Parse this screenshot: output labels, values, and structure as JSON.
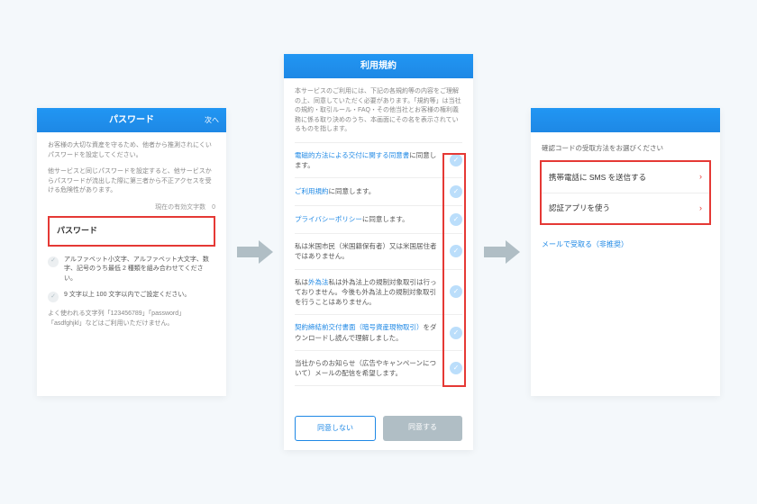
{
  "screen1": {
    "title": "パスワード",
    "next": "次へ",
    "desc1": "お客様の大切な資産を守るため、他者から推測されにくいパスワードを設定してください。",
    "desc2": "他サービスと同じパスワードを設定すると、他サービスからパスワードが流出した際に第三者から不正アクセスを受ける危険性があります。",
    "counter": "現在の有効文字数　0",
    "placeholder": "パスワード",
    "rule1": "アルファベット小文字、アルファベット大文字、数字、記号のうち最低 2 種類を組み合わせてください。",
    "rule2": "9 文字以上 100 文字以内でご設定ください。",
    "tip": "よく使われる文字列「123456789」「password」「asdfghjkl」などはご利用いただけません。"
  },
  "screen2": {
    "title": "利用規約",
    "intro": "本サービスのご利用には、下記の各規約等の内容をご理解の上、同意していただく必要があります。「規約等」は当社の規約・取引ルール・FAQ・その他当社とお客様の権利義務に係る取り決めのうち、本画面にその名を表示されているものを指します。",
    "terms": [
      {
        "link": "電磁的方法による交付に関する同意書",
        "rest": "に同意します。"
      },
      {
        "link": "ご利用規約",
        "rest": "に同意します。"
      },
      {
        "link": "プライバシーポリシー",
        "rest": "に同意します。"
      },
      {
        "link": "",
        "rest": "私は米国市民（米国籍保有者）又は米国居住者ではありません。"
      },
      {
        "link": "外為法",
        "rest": "私は外為法上の規制対象取引は行っておりません。今後も外為法上の規制対象取引を行うことはありません。",
        "prefix": "私は"
      },
      {
        "link": "契約締結前交付書面（暗号資産現物取引）",
        "rest": "をダウンロードし読んで理解しました。"
      },
      {
        "link": "",
        "rest": "当社からのお知らせ（広告やキャンペーンについて）メールの配信を希望します。"
      }
    ],
    "btn_decline": "同意しない",
    "btn_agree": "同意する"
  },
  "screen3": {
    "instruction": "確認コードの受取方法をお選びください",
    "options": [
      "携帯電話に SMS を送信する",
      "認証アプリを使う"
    ],
    "mail_link": "メールで受取る（非推奨）"
  }
}
